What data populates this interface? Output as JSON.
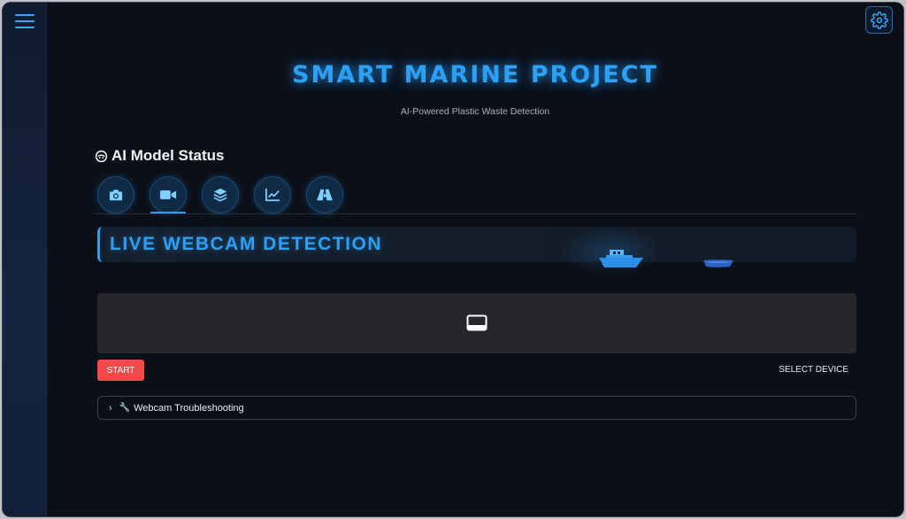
{
  "header": {
    "title": "SMART MARINE PROJECT",
    "subtitle": "AI-Powered Plastic Waste Detection"
  },
  "icons": {
    "menu": "hamburger-menu-icon",
    "settings": "gear-icon",
    "status": "brain-icon",
    "tabs": [
      "camera-icon",
      "video-camera-icon",
      "layers-icon",
      "line-chart-icon",
      "map-icon"
    ],
    "webcam": "monitor-icon",
    "troubleshoot": "wrench-icon"
  },
  "status": {
    "label": "AI Model Status"
  },
  "tabs": {
    "active_index": 1
  },
  "section": {
    "title": "LIVE WEBCAM DETECTION"
  },
  "webcam": {
    "start_label": "START",
    "select_device_label": "SELECT DEVICE"
  },
  "troubleshooting": {
    "icon_glyph": "🔧",
    "label": "Webcam Troubleshooting"
  },
  "colors": {
    "accent": "#2ea0f4",
    "start": "#f04a4a",
    "background": "#0c0f17"
  }
}
